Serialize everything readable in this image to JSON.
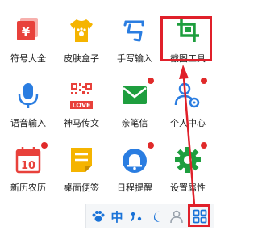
{
  "toolbox": {
    "rows": [
      [
        {
          "label": "符号大全",
          "icon": "yen-symbol-icon",
          "color": "#e8413b",
          "dot": false
        },
        {
          "label": "皮肤盒子",
          "icon": "tshirt-paw-icon",
          "color": "#f5b400",
          "dot": false
        },
        {
          "label": "手写输入",
          "icon": "handwriting-icon",
          "color": "#2a7de1",
          "dot": false
        },
        {
          "label": "截图工具",
          "icon": "screenshot-crop-icon",
          "color": "#1e9e3e",
          "dot": false
        }
      ],
      [
        {
          "label": "语音输入",
          "icon": "microphone-icon",
          "color": "#2a7de1",
          "dot": false
        },
        {
          "label": "神马传文",
          "icon": "qr-love-icon",
          "color": "#e8413b",
          "dot": false
        },
        {
          "label": "亲笔信",
          "icon": "envelope-icon",
          "color": "#1e9e3e",
          "dot": true
        },
        {
          "label": "个人中心",
          "icon": "user-settings-icon",
          "color": "#2a7de1",
          "dot": true
        }
      ],
      [
        {
          "label": "新历农历",
          "icon": "calendar-10-icon",
          "color": "#e8413b",
          "dot": true
        },
        {
          "label": "桌面便签",
          "icon": "sticky-note-icon",
          "color": "#f5b400",
          "dot": false
        },
        {
          "label": "日程提醒",
          "icon": "bell-icon",
          "color": "#2a7de1",
          "dot": true
        },
        {
          "label": "设置属性",
          "icon": "gear-icon",
          "color": "#1e9e3e",
          "dot": true
        }
      ]
    ]
  },
  "taskbar": {
    "lang_label": "中",
    "items": [
      "paw-icon",
      "lang-zh",
      "punctuation-icon",
      "moon-icon",
      "user-icon",
      "grid-icon"
    ]
  },
  "highlight": {
    "color": "#e0202a",
    "target": "截图工具"
  }
}
